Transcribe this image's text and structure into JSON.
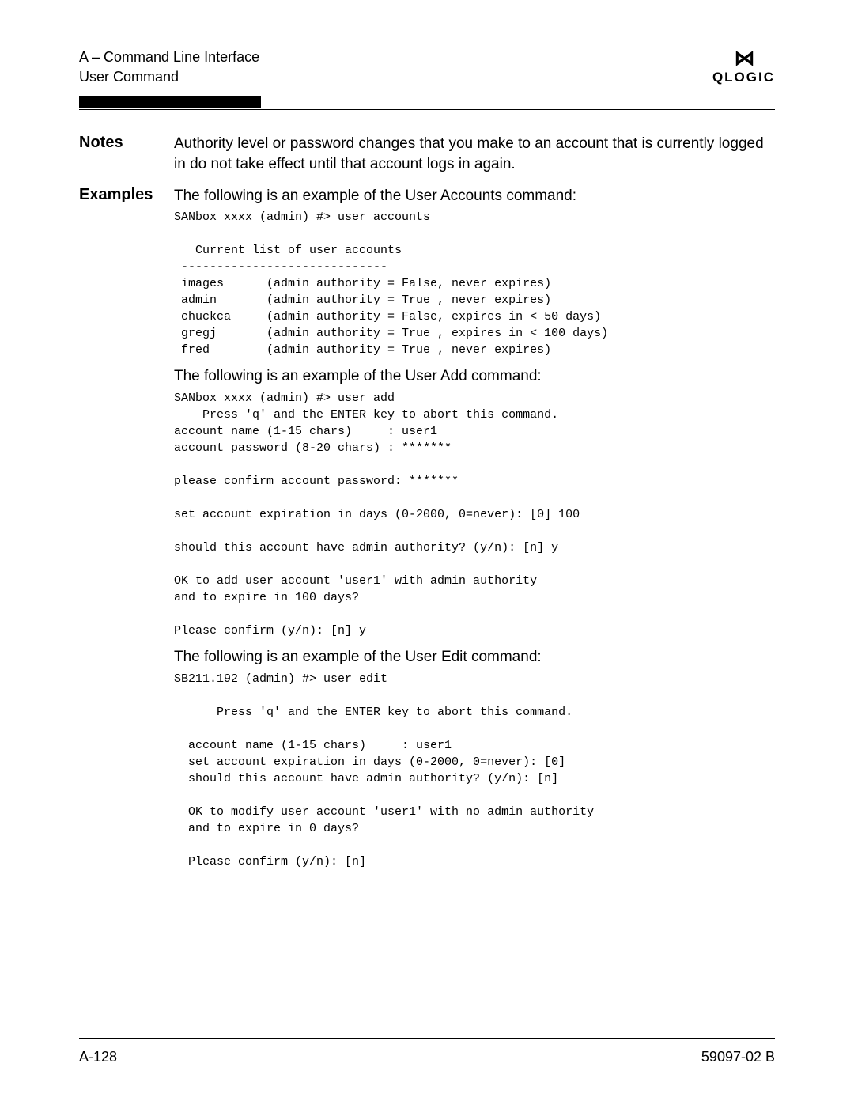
{
  "header": {
    "line1": "A – Command Line Interface",
    "line2": "User Command",
    "logo_text": "QLOGIC"
  },
  "notes": {
    "label": "Notes",
    "text": "Authority level or password changes that you make to an account that is currently logged in do not take effect until that account logs in again."
  },
  "examples": {
    "label": "Examples",
    "intro1": "The following is an example of the User Accounts command:",
    "code1": "SANbox xxxx (admin) #> user accounts\n\n   Current list of user accounts\n -----------------------------\n images      (admin authority = False, never expires)\n admin       (admin authority = True , never expires)\n chuckca     (admin authority = False, expires in < 50 days)\n gregj       (admin authority = True , expires in < 100 days)\n fred        (admin authority = True , never expires)",
    "intro2": "The following is an example of the User Add command:",
    "code2": "SANbox xxxx (admin) #> user add\n    Press 'q' and the ENTER key to abort this command.\naccount name (1-15 chars)     : user1\naccount password (8-20 chars) : *******\n\nplease confirm account password: *******\n\nset account expiration in days (0-2000, 0=never): [0] 100\n\nshould this account have admin authority? (y/n): [n] y\n\nOK to add user account 'user1' with admin authority\nand to expire in 100 days?\n\nPlease confirm (y/n): [n] y",
    "intro3": "The following is an example of the User Edit command:",
    "code3": "SB211.192 (admin) #> user edit\n\n      Press 'q' and the ENTER key to abort this command.\n\n  account name (1-15 chars)     : user1\n  set account expiration in days (0-2000, 0=never): [0]\n  should this account have admin authority? (y/n): [n]\n\n  OK to modify user account 'user1' with no admin authority\n  and to expire in 0 days?\n\n  Please confirm (y/n): [n]"
  },
  "footer": {
    "page": "A-128",
    "docnum": "59097-02 B"
  }
}
